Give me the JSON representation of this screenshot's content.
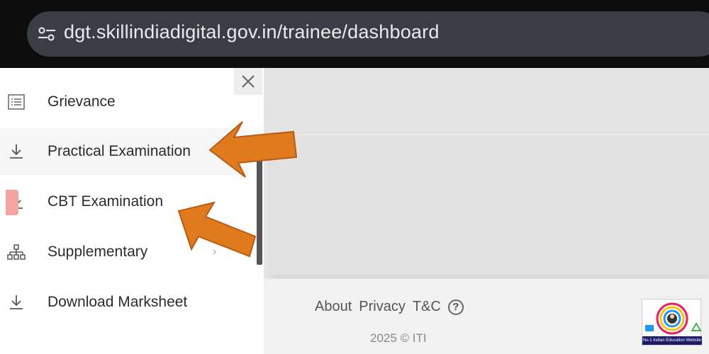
{
  "browser": {
    "url": "dgt.skillindiadigital.gov.in/trainee/dashboard",
    "site_settings_icon": "tune-icon"
  },
  "sidebar": {
    "close_icon": "close-icon",
    "items": [
      {
        "label": "Grievance",
        "icon": "list-icon"
      },
      {
        "label": "Practical Examination",
        "icon": "download-icon"
      },
      {
        "label": "CBT Examination",
        "icon": "download-icon"
      },
      {
        "label": "Supplementary",
        "icon": "sitemap-icon",
        "chevron": "›"
      },
      {
        "label": "Download Marksheet",
        "icon": "download-icon"
      }
    ]
  },
  "footer": {
    "about": "About",
    "privacy": "Privacy",
    "tc": "T&C",
    "help": "?",
    "copyright": "2025 © ITI"
  },
  "watermark": {
    "caption": "No.1 Indian Education Website"
  },
  "colors": {
    "arrow": "#e07a1f",
    "url_bar": "#3a3e44",
    "sidebar_bg": "#ffffff",
    "page_bg": "#e6e6e6"
  }
}
